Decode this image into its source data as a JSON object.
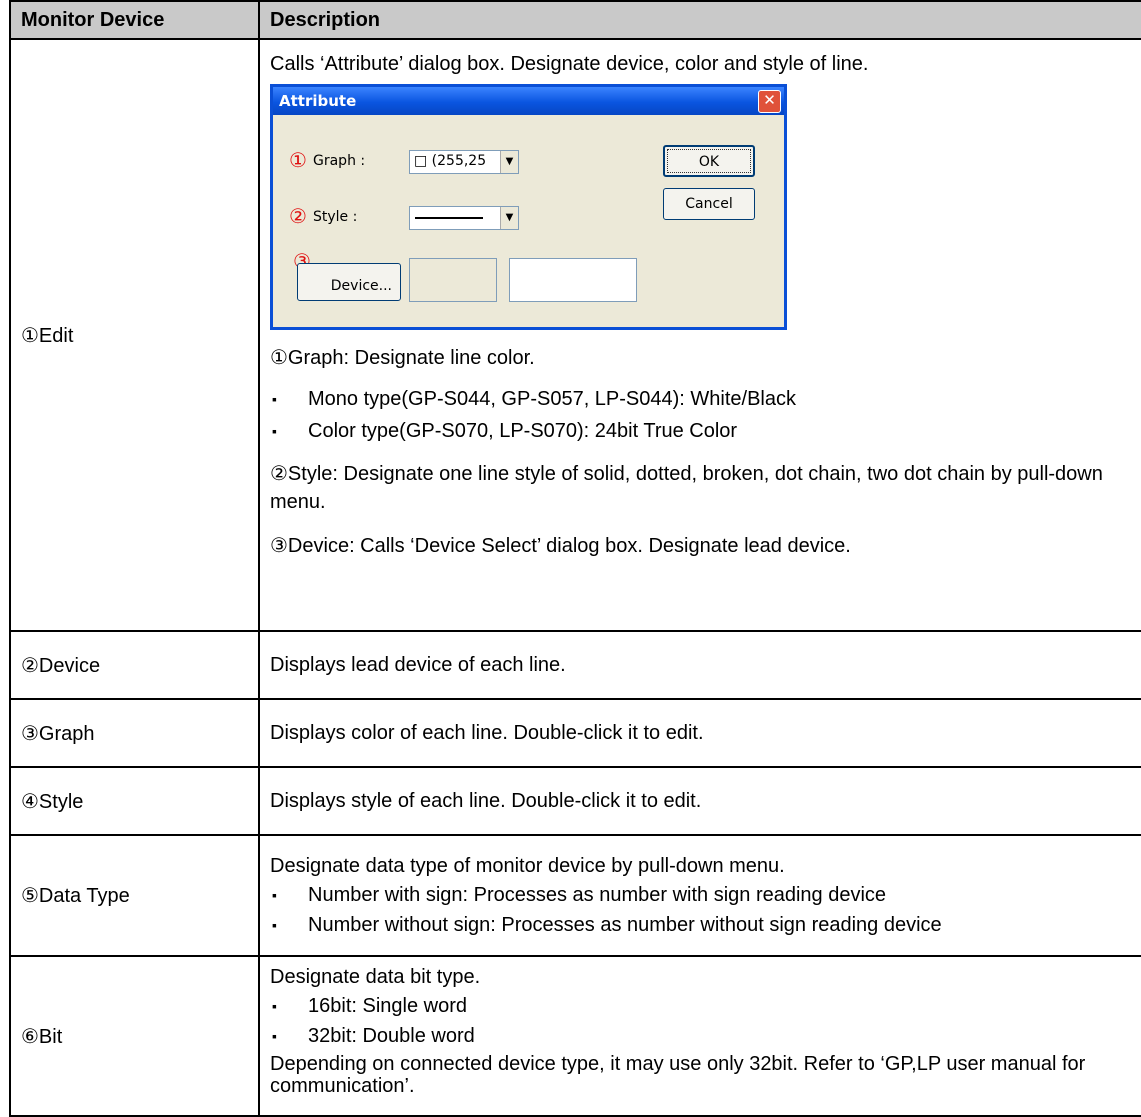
{
  "header": {
    "col1": "Monitor Device",
    "col2": "Description"
  },
  "rows": {
    "edit": {
      "name": "①Edit",
      "intro": "Calls ‘Attribute’ dialog box. Designate device, color and style of line.",
      "dialog": {
        "title": "Attribute",
        "close": "✕",
        "graph_num": "①",
        "graph_label": "Graph :",
        "graph_value": "□ (255,25",
        "style_num": "②",
        "style_label": "Style :",
        "device_num": "③",
        "device_button": "Device...",
        "ok": "OK",
        "cancel": "Cancel",
        "arrow": "▼"
      },
      "graph_desc": "①Graph: Designate line color.",
      "bullets": [
        "Mono type(GP-S044, GP-S057, LP-S044): White/Black",
        "Color type(GP-S070, LP-S070): 24bit True Color"
      ],
      "style_desc": "②Style: Designate one line style of solid, dotted, broken, dot chain, two dot chain by pull-down menu.",
      "device_desc": "③Device: Calls ‘Device Select’ dialog box. Designate lead device."
    },
    "device": {
      "name": "②Device",
      "desc": "Displays lead device of each line."
    },
    "graph": {
      "name": "③Graph",
      "desc": "Displays color of each line. Double-click it to edit."
    },
    "style": {
      "name": "④Style",
      "desc": "Displays style of each line. Double-click it to edit."
    },
    "datatype": {
      "name": "⑤Data Type",
      "desc": "Designate data type of monitor device by pull-down menu.",
      "bullets": [
        "Number with sign: Processes as number with sign reading device",
        "Number without sign: Processes as number without sign reading device"
      ]
    },
    "bit": {
      "name": "⑥Bit",
      "desc": "Designate data bit type.",
      "bullets": [
        "16bit: Single word",
        "32bit: Double word"
      ],
      "note": "Depending on connected device type, it may use only 32bit. Refer to ‘GP,LP user manual for communication’."
    }
  }
}
